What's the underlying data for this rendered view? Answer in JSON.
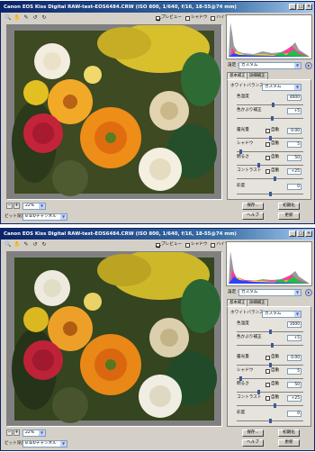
{
  "windows": [
    {
      "title": "Canon EOS Kiss Digital  RAW-test-EOS6484.CRW  (ISO 800, 1/640, f/16, 18-55@74 mm)",
      "title_controls": [
        "_",
        "□",
        "×"
      ],
      "toolbar": {
        "preview_label": "プレビュー",
        "preview_checked": true,
        "shadow_label": "シャドウ",
        "shadow_checked": false,
        "highlight_label": "ハイライト",
        "highlight_checked": false
      },
      "zoom_value": "22%",
      "bit_depth_label": "ビット深度 :",
      "bit_depth_value": "8 bit/チャンネル",
      "settings": {
        "label": "設定 :",
        "value": "カスタム"
      },
      "tabs": [
        "基本補正",
        "詳細補正"
      ],
      "white_balance": {
        "label": "ホワイトバランス :",
        "value": "カスタム"
      },
      "color_temperature": {
        "label": "色温度",
        "value": "4000",
        "level": 0.55
      },
      "tint": {
        "label": "色かぶり補正",
        "value": "+5",
        "level": 0.54
      },
      "exposure": {
        "label": "露光量",
        "auto_label": "自動",
        "value": "0.00",
        "level": 0.5
      },
      "shadows": {
        "label": "シャドウ",
        "auto_label": "自動",
        "value": "5",
        "level": 0.06
      },
      "brightness": {
        "label": "明るさ",
        "auto_label": "自動",
        "value": "50",
        "level": 0.33
      },
      "contrast": {
        "label": "コントラスト",
        "auto_label": "自動",
        "value": "+25",
        "level": 0.58
      },
      "saturation": {
        "label": "彩度",
        "value": "0",
        "level": 0.5
      },
      "buttons": {
        "save": "保存...",
        "reset": "初期化",
        "help": "ヘルプ",
        "update": "更新"
      }
    },
    {
      "title": "Canon EOS Kiss Digital  RAW-test-EOS6484.CRW  (ISO 800, 1/640, f/16, 18-55@74 mm)",
      "title_controls": [
        "_",
        "□",
        "×"
      ],
      "toolbar": {
        "preview_label": "プレビュー",
        "preview_checked": true,
        "shadow_label": "シャドウ",
        "shadow_checked": false,
        "highlight_label": "ハイライト",
        "highlight_checked": false
      },
      "zoom_value": "22%",
      "bit_depth_label": "ビット深度 :",
      "bit_depth_value": "8 bit/チャンネル",
      "settings": {
        "label": "設定 :",
        "value": "カスタム"
      },
      "tabs": [
        "基本補正",
        "詳細補正"
      ],
      "white_balance": {
        "label": "ホワイトバランス :",
        "value": "カスタム"
      },
      "color_temperature": {
        "label": "色温度",
        "value": "3500",
        "level": 0.5
      },
      "tint": {
        "label": "色かぶり補正",
        "value": "+5",
        "level": 0.54
      },
      "exposure": {
        "label": "露光量",
        "auto_label": "自動",
        "value": "0.00",
        "level": 0.5
      },
      "shadows": {
        "label": "シャドウ",
        "auto_label": "自動",
        "value": "5",
        "level": 0.06
      },
      "brightness": {
        "label": "明るさ",
        "auto_label": "自動",
        "value": "50",
        "level": 0.33
      },
      "contrast": {
        "label": "コントラスト",
        "auto_label": "自動",
        "value": "+25",
        "level": 0.58
      },
      "saturation": {
        "label": "彩度",
        "value": "0",
        "level": 0.5
      },
      "buttons": {
        "save": "保存...",
        "reset": "初期化",
        "help": "ヘルプ",
        "update": "更新"
      }
    }
  ]
}
